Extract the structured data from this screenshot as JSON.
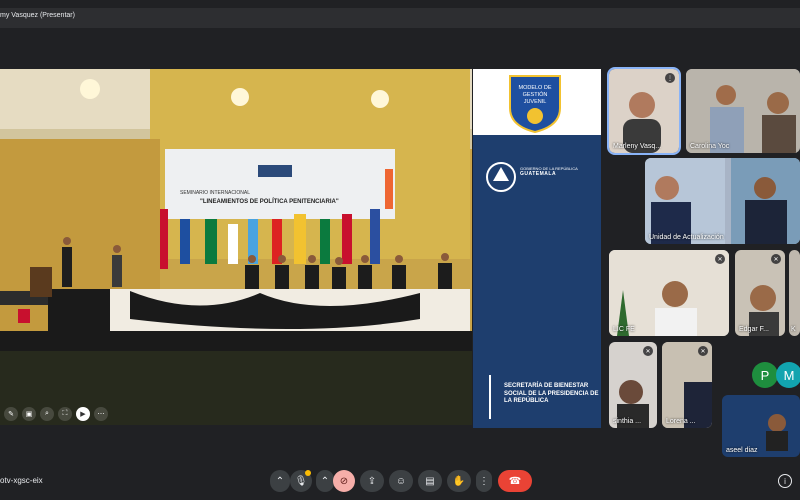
{
  "presenter_label": "my Vasquez (Presentar)",
  "meeting_code": "otv-xgsc-eix",
  "slide": {
    "banner_line1": "SEMINARIO INTERNACIONAL",
    "banner_line2": "\"LINEAMIENTOS DE POLÍTICA PENITENCIARIA\""
  },
  "side_panel": {
    "logo_line1": "MODELO DE",
    "logo_line2": "GESTIÓN",
    "logo_line3": "JUVENIL",
    "gov_small": "GOBIERNO DE LA REPÚBLICA",
    "gov_big": "GUATEMALA",
    "secretaria": "SECRETARÍA DE BIENESTAR SOCIAL DE LA PRESIDENCIA DE LA REPÚBLICA"
  },
  "participants": [
    {
      "name": "Marleny Vasq..."
    },
    {
      "name": "Carolina Yoc"
    },
    {
      "name": "Unidad de Actualización"
    },
    {
      "name": "LIC FE"
    },
    {
      "name": "Edgar F..."
    },
    {
      "name": "K"
    },
    {
      "name": "sinthia ..."
    },
    {
      "name": "Lorena ..."
    },
    {
      "name": "aseel diaz"
    }
  ],
  "avatars": [
    {
      "initial": "P",
      "color": "#1e8e3e"
    },
    {
      "initial": "M",
      "color": "#12a4af"
    }
  ],
  "controls": {
    "more": "⋮",
    "info": "i"
  }
}
